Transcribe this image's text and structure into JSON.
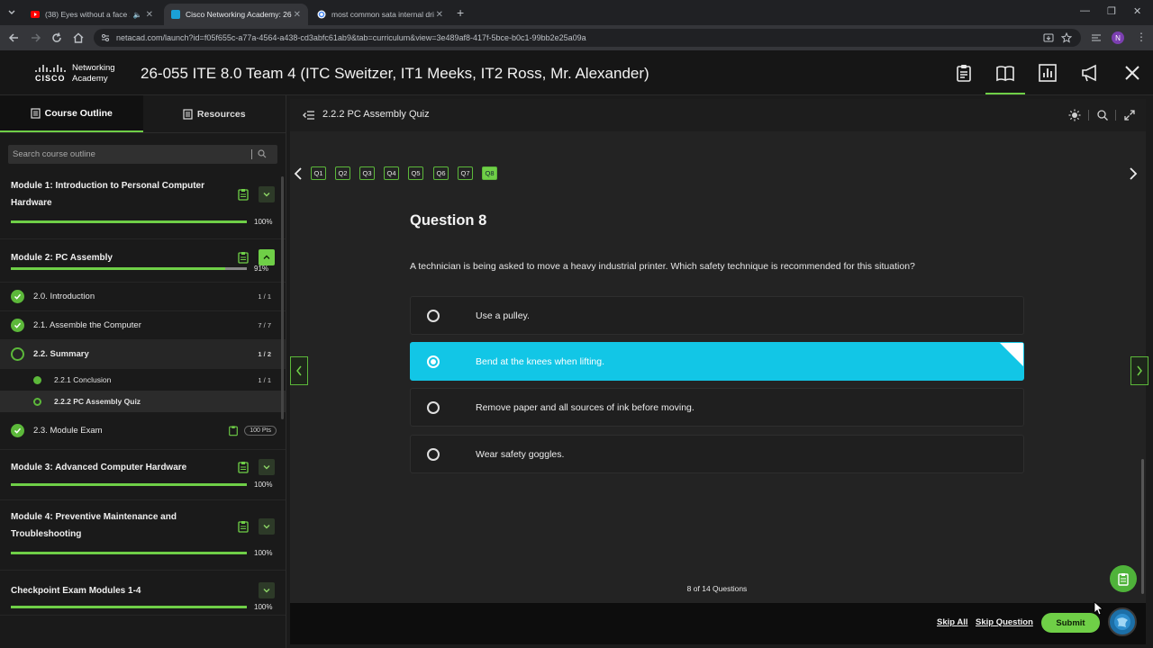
{
  "browser": {
    "tabs": [
      {
        "title": "(38) Eyes without a face x S",
        "favicon_color": "#ff0000"
      },
      {
        "title": "Cisco Networking Academy: 26",
        "favicon_color": "#1ba0d7"
      },
      {
        "title": "most common sata internal dri",
        "favicon_color": "#4285f4"
      }
    ],
    "new_tab": "+",
    "url": "netacad.com/launch?id=f05f655c-a77a-4564-a438-cd3abfc61ab9&tab=curriculum&view=3e489af8-417f-5bce-b0c1-99bb2e25a09a",
    "profile_initial": "N"
  },
  "app": {
    "logo_line1": "Networking",
    "logo_line2": "Academy",
    "logo_brand": "CISCO",
    "course_title": "26-055 ITE 8.0 Team 4 (ITC Sweitzer, IT1 Meeks, IT2 Ross, Mr. Alexander)"
  },
  "sidebar": {
    "tabs": {
      "outline": "Course Outline",
      "resources": "Resources"
    },
    "search_placeholder": "Search course outline",
    "modules": [
      {
        "title": "Module 1: Introduction to Personal Computer Hardware",
        "progress": 100,
        "progress_label": "100%"
      },
      {
        "title": "Module 2: PC Assembly",
        "progress": 91,
        "progress_label": "91%",
        "lessons": [
          {
            "label": "2.0. Introduction",
            "count": "1 / 1",
            "status": "complete"
          },
          {
            "label": "2.1. Assemble the Computer",
            "count": "7 / 7",
            "status": "complete"
          },
          {
            "label": "2.2. Summary",
            "count": "1 / 2",
            "status": "in-progress",
            "subs": [
              {
                "label": "2.2.1 Conclusion",
                "count": "1 / 1",
                "status": "complete"
              },
              {
                "label": "2.2.2 PC Assembly Quiz",
                "count": "",
                "status": "current"
              }
            ]
          },
          {
            "label": "2.3. Module Exam",
            "count": "100 Pts",
            "status": "complete"
          }
        ]
      },
      {
        "title": "Module 3: Advanced Computer Hardware",
        "progress": 100,
        "progress_label": "100%"
      },
      {
        "title": "Module 4: Preventive Maintenance and Troubleshooting",
        "progress": 100,
        "progress_label": "100%"
      },
      {
        "title": "Checkpoint Exam Modules 1-4",
        "progress": 100,
        "progress_label": "100%"
      }
    ]
  },
  "quiz": {
    "title": "2.2.2 PC Assembly Quiz",
    "question_chips": [
      "Q1",
      "Q2",
      "Q3",
      "Q4",
      "Q5",
      "Q6",
      "Q7",
      "Q8"
    ],
    "active_chip": 7,
    "heading": "Question 8",
    "question": "A technician is being asked to move a heavy industrial printer. Which safety technique is recommended for this situation?",
    "answers": [
      {
        "text": "Use a pulley.",
        "selected": false
      },
      {
        "text": "Bend at the knees when lifting.",
        "selected": true
      },
      {
        "text": "Remove paper and all sources of ink before moving.",
        "selected": false
      },
      {
        "text": "Wear safety goggles.",
        "selected": false
      }
    ],
    "counter": "8 of 14 Questions",
    "selected_color": "#12c6e6"
  },
  "footer": {
    "skip_all": "Skip All",
    "skip_question": "Skip Question",
    "submit": "Submit"
  },
  "colors": {
    "accent": "#6fcf47",
    "selected": "#12c6e6",
    "background": "#232323"
  }
}
